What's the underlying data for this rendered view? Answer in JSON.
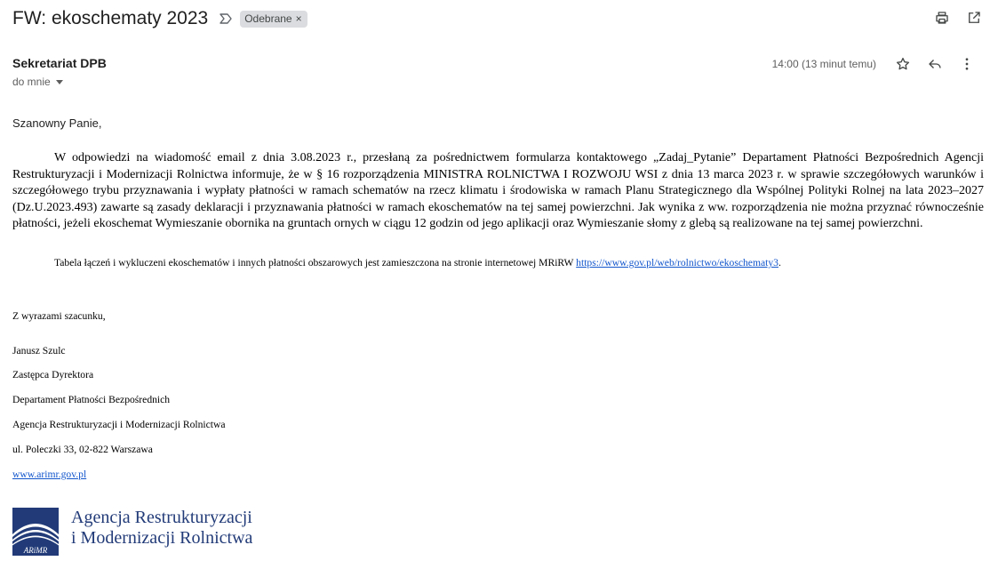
{
  "header": {
    "subject": "FW: ekoschematy 2023",
    "label_chip": "Odebrane",
    "label_chip_remove": "×",
    "actions": [
      "print-icon",
      "open-in-new-window-icon"
    ]
  },
  "message": {
    "sender_name": "Sekretariat DPB",
    "recipient": "do mnie",
    "time": "14:00 (13 minut temu)",
    "actions": [
      "star-icon",
      "reply-icon",
      "more-options-icon"
    ],
    "greeting": "Szanowny Panie,",
    "paragraph": "W odpowiedzi na wiadomość email z dnia 3.08.2023 r., przesłaną za pośrednictwem formularza kontaktowego „Zadaj_Pytanie” Departament Płatności Bezpośrednich Agencji Restrukturyzacji i Modernizacji Rolnictwa informuje, że w § 16 rozporządzenia MINISTRA ROLNICTWA I ROZWOJU WSI z dnia 13 marca 2023 r. w sprawie szczegółowych warunków i szczegółowego trybu przyznawania i wypłaty płatności w ramach schematów na rzecz klimatu i środowiska w ramach Planu Strategicznego dla Wspólnej Polityki Rolnej na lata 2023–2027 (Dz.U.2023.493) zawarte są zasady deklaracji i przyznawania płatności w ramach ekoschematów na tej samej powierzchni. Jak wynika z ww. rozporządzenia nie można przyznać równocześnie płatności, jeżeli ekoschemat Wymieszanie obornika na gruntach ornych w ciągu 12 godzin od jego aplikacji oraz Wymieszanie słomy z glebą są realizowane na tej samej powierzchni.",
    "table_note_text": "Tabela łączeń i wykluczeni ekoschematów i innych płatności obszarowych jest zamieszczona na stronie internetowej MRiRW ",
    "table_note_link": "https://www.gov.pl/web/rolnictwo/ekoschematy3",
    "table_note_end": "."
  },
  "signature": {
    "closing": "Z wyrazami szacunku,",
    "name": "Janusz Szulc",
    "position": "Zastępca Dyrektora",
    "department": "Departament Płatności Bezpośrednich",
    "agency": "Agencja Restrukturyzacji i Modernizacji Rolnictwa",
    "address": "ul. Poleczki 33, 02-822 Warszawa",
    "website": "www.arimr.gov.pl"
  },
  "logo": {
    "badge_text": "ARiMR",
    "line1": "Agencja Restrukturyzacji",
    "line2": "i Modernizacji Rolnictwa",
    "color": "#223b78"
  }
}
